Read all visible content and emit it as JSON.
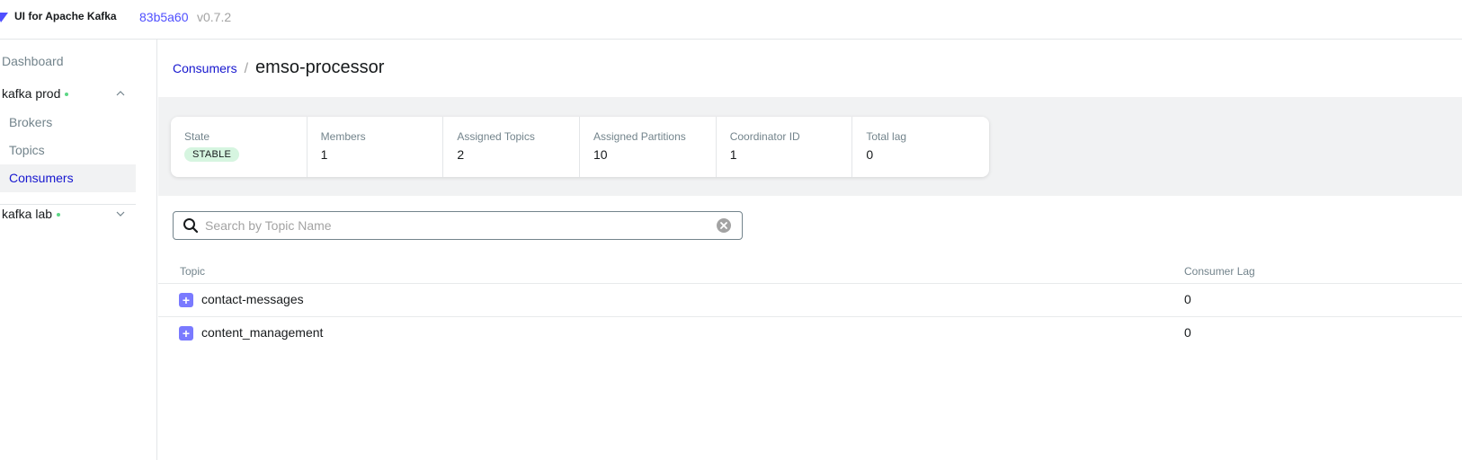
{
  "header": {
    "app_title": "UI for Apache Kafka",
    "commit": "83b5a60",
    "version": "v0.7.2"
  },
  "sidebar": {
    "dashboard": "Dashboard",
    "clusters": [
      {
        "name": "kafka prod",
        "expanded": true,
        "status_color": "#5cd685",
        "items": [
          {
            "label": "Brokers",
            "active": false
          },
          {
            "label": "Topics",
            "active": false
          },
          {
            "label": "Consumers",
            "active": true
          }
        ]
      },
      {
        "name": "kafka lab",
        "expanded": false,
        "status_color": "#5cd685"
      }
    ]
  },
  "breadcrumb": {
    "parent": "Consumers",
    "separator": "/",
    "current": "emso-processor"
  },
  "stats": [
    {
      "label": "State",
      "value": "STABLE",
      "is_badge": true
    },
    {
      "label": "Members",
      "value": "1"
    },
    {
      "label": "Assigned Topics",
      "value": "2"
    },
    {
      "label": "Assigned Partitions",
      "value": "10"
    },
    {
      "label": "Coordinator ID",
      "value": "1"
    },
    {
      "label": "Total lag",
      "value": "0"
    }
  ],
  "search": {
    "placeholder": "Search by Topic Name",
    "value": ""
  },
  "table": {
    "columns": [
      "Topic",
      "Consumer Lag"
    ],
    "rows": [
      {
        "topic": "contact-messages",
        "lag": "0"
      },
      {
        "topic": "content_management",
        "lag": "0"
      }
    ]
  },
  "colors": {
    "accent": "#4f4fff",
    "link": "#1717cf",
    "status_online": "#5cd685",
    "badge_bg": "#d6f5e0",
    "expand_button": "#7a7aff"
  }
}
